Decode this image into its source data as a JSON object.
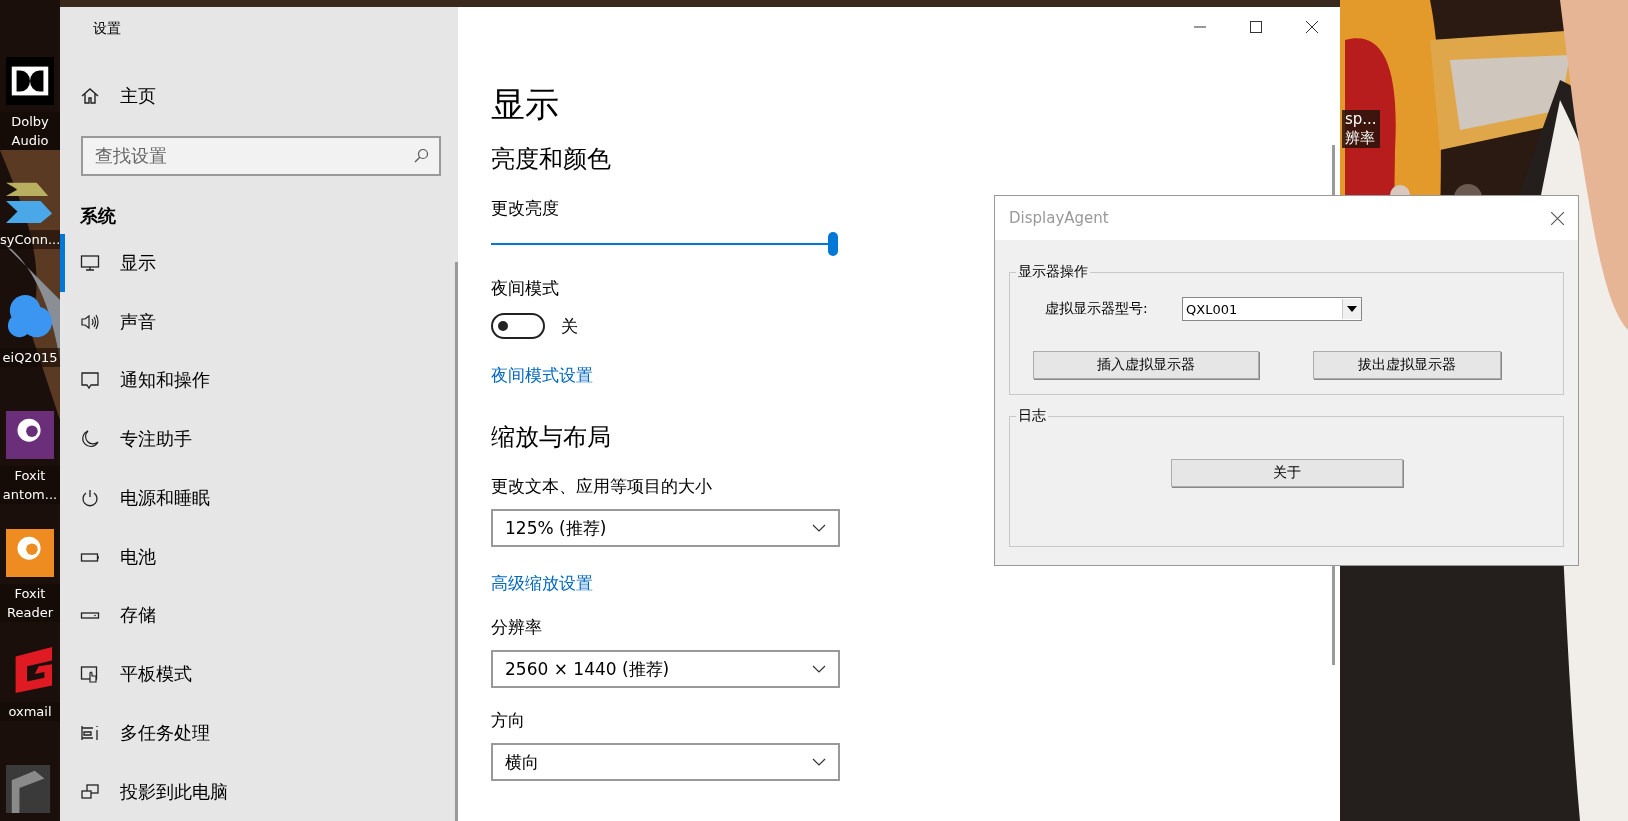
{
  "desktop": {
    "icons": [
      {
        "kind": "dolby",
        "label": "Dolby Audio"
      },
      {
        "kind": "chevrons",
        "label": "syConn..."
      },
      {
        "kind": "people",
        "label": "eiQ2015"
      },
      {
        "kind": "foxit-purple",
        "label": "Foxit antom..."
      },
      {
        "kind": "foxit-orange",
        "label": "Foxit Reader"
      },
      {
        "kind": "foxmail",
        "label": "oxmail"
      },
      {
        "kind": "gray"
      }
    ],
    "right_icon_label": [
      "sp...",
      "辨率"
    ]
  },
  "settings_window": {
    "title": "设置",
    "sidebar": {
      "home": "主页",
      "search": {
        "placeholder": "查找设置"
      },
      "section": "系统",
      "items": [
        {
          "kind": "display",
          "label": "显示",
          "selected": true
        },
        {
          "kind": "sound",
          "label": "声音",
          "selected": false
        },
        {
          "kind": "notify",
          "label": "通知和操作",
          "selected": false
        },
        {
          "kind": "moon",
          "label": "专注助手",
          "selected": false
        },
        {
          "kind": "power",
          "label": "电源和睡眠",
          "selected": false
        },
        {
          "kind": "battery",
          "label": "电池",
          "selected": false
        },
        {
          "kind": "storage",
          "label": "存储",
          "selected": false
        },
        {
          "kind": "tablet",
          "label": "平板模式",
          "selected": false
        },
        {
          "kind": "multitask",
          "label": "多任务处理",
          "selected": false
        },
        {
          "kind": "project",
          "label": "投影到此电脑",
          "selected": false
        }
      ]
    },
    "content": {
      "title": "显示",
      "sections": [
        {
          "heading": "亮度和颜色",
          "controls": [
            {
              "kind": "slider",
              "label": "更改亮度",
              "level": 1.0
            },
            {
              "kind": "toggle",
              "label": "夜间模式",
              "on": false,
              "state_text": "关"
            },
            {
              "kind": "link",
              "text": "夜间模式设置"
            }
          ]
        },
        {
          "heading": "缩放与布局",
          "controls": [
            {
              "kind": "dropdown",
              "label": "更改文本、应用等项目的大小",
              "value": "125% (推荐)"
            },
            {
              "kind": "link",
              "text": "高级缩放设置"
            },
            {
              "kind": "dropdown",
              "label": "分辨率",
              "value": "2560 × 1440 (推荐)"
            },
            {
              "kind": "dropdown",
              "label": "方向",
              "value": "横向"
            }
          ]
        }
      ]
    }
  },
  "dialog": {
    "title": "DisplayAgent",
    "operations_group": {
      "title": "显示器操作",
      "model_label": "虚拟显示器型号:",
      "model_value": "QXL001",
      "buttons": [
        "插入虚拟显示器",
        "拔出虚拟显示器"
      ]
    },
    "log_group": {
      "title": "日志",
      "button": "关于"
    }
  }
}
